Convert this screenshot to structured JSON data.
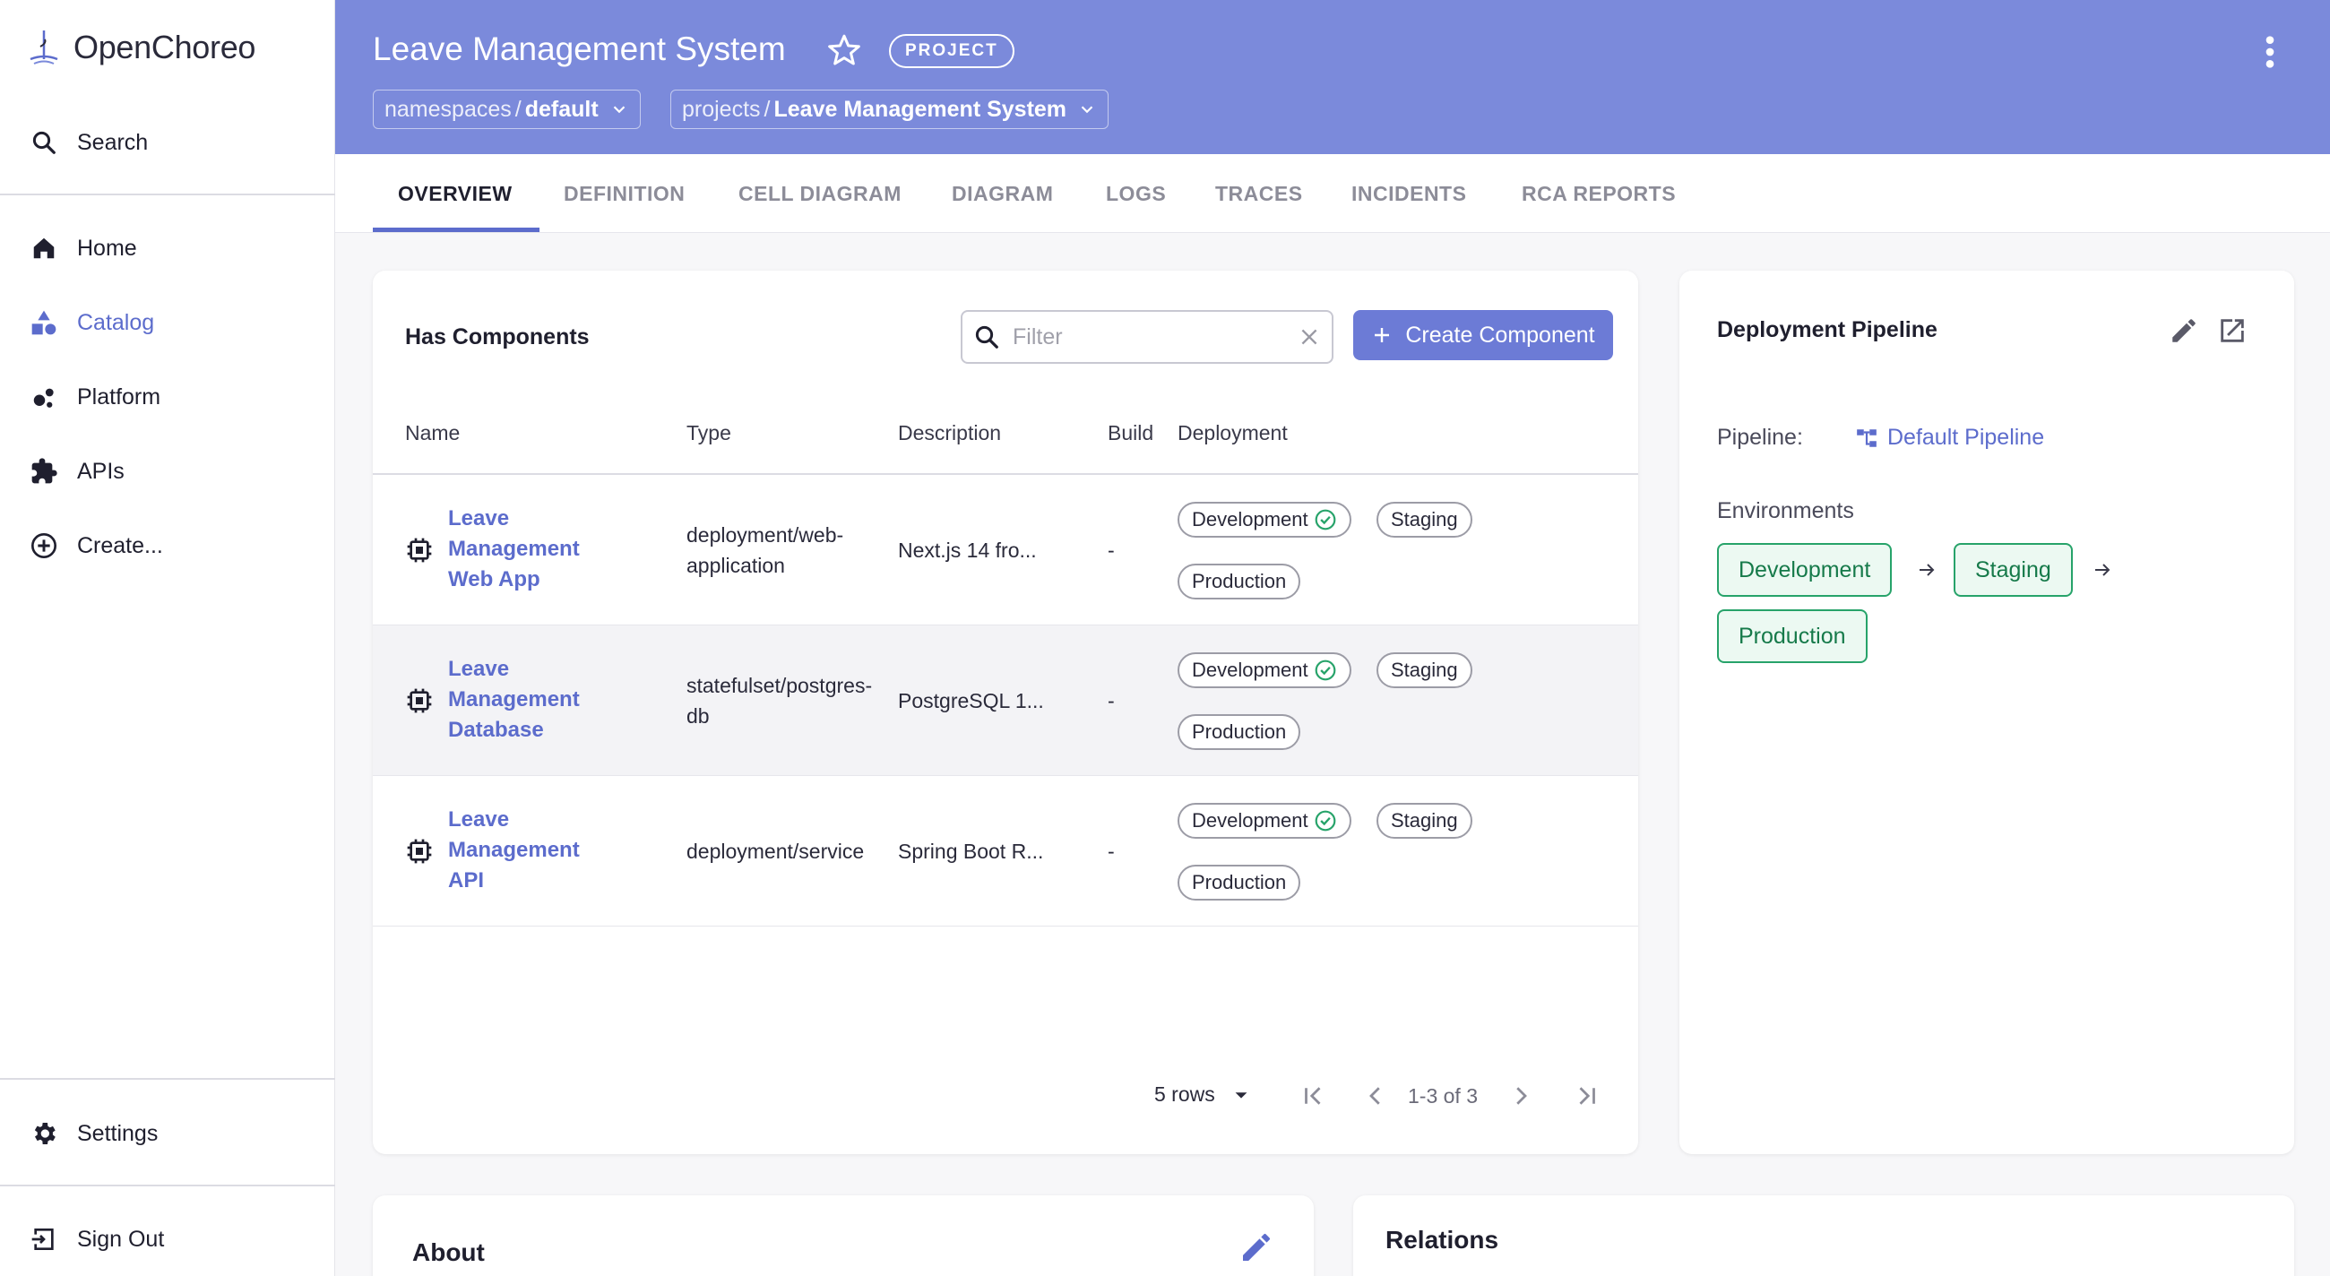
{
  "brand": {
    "name": "OpenChoreo"
  },
  "sidebar": {
    "search": "Search",
    "items": [
      {
        "label": "Home",
        "icon": "home-icon"
      },
      {
        "label": "Catalog",
        "icon": "catalog-icon",
        "active": true
      },
      {
        "label": "Platform",
        "icon": "platform-icon"
      },
      {
        "label": "APIs",
        "icon": "puzzle-icon"
      },
      {
        "label": "Create...",
        "icon": "add-circle-icon"
      }
    ],
    "settings": "Settings",
    "signout": "Sign Out"
  },
  "header": {
    "title": "Leave Management System",
    "chip": "PROJECT",
    "crumbs": [
      {
        "prefix": "namespaces",
        "sep": "/",
        "value": "default"
      },
      {
        "prefix": "projects",
        "sep": "/",
        "value": "Leave Management System"
      }
    ]
  },
  "tabs": [
    "OVERVIEW",
    "DEFINITION",
    "CELL DIAGRAM",
    "DIAGRAM",
    "LOGS",
    "TRACES",
    "INCIDENTS",
    "RCA REPORTS"
  ],
  "components": {
    "title": "Has Components",
    "filter_placeholder": "Filter",
    "create_label": "Create Component",
    "columns": [
      "Name",
      "Type",
      "Description",
      "Build",
      "Deployment"
    ],
    "rows": [
      {
        "name_lines": [
          "Leave",
          "Management",
          "Web App"
        ],
        "type_lines": [
          "deployment/web-",
          "application"
        ],
        "description": "Next.js 14 fro...",
        "build": "-",
        "envs": [
          "Development",
          "Staging",
          "Production"
        ]
      },
      {
        "name_lines": [
          "Leave",
          "Management",
          "Database"
        ],
        "type_lines": [
          "statefulset/postgres-",
          "db"
        ],
        "description": "PostgreSQL 1...",
        "build": "-",
        "envs": [
          "Development",
          "Staging",
          "Production"
        ]
      },
      {
        "name_lines": [
          "Leave",
          "Management",
          "API"
        ],
        "type_lines": [
          "deployment/service"
        ],
        "description": "Spring Boot R...",
        "build": "-",
        "envs": [
          "Development",
          "Staging",
          "Production"
        ]
      }
    ],
    "pager": {
      "rows_label": "5 rows",
      "range": "1-3 of 3"
    }
  },
  "pipeline": {
    "title": "Deployment Pipeline",
    "pipeline_label": "Pipeline:",
    "pipeline_link": "Default Pipeline",
    "environments_label": "Environments",
    "stages": [
      "Development",
      "Staging",
      "Production"
    ]
  },
  "about": {
    "title": "About"
  },
  "relations": {
    "title": "Relations"
  },
  "colors": {
    "accent": "#6c7bd6",
    "header": "#7b8adb",
    "success": "#27a36a",
    "link": "#5c6ccc"
  }
}
